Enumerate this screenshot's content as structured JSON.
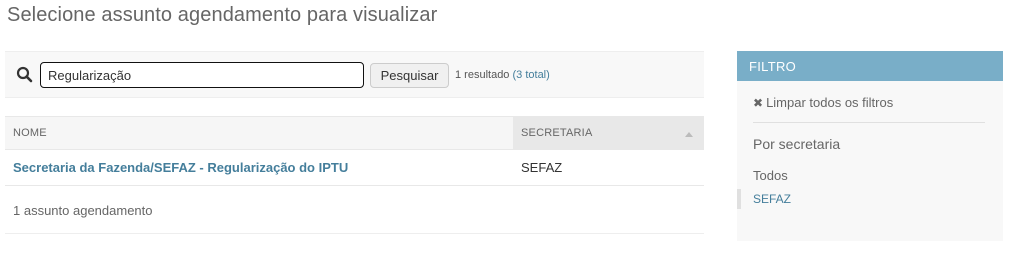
{
  "page": {
    "title": "Selecione assunto agendamento para visualizar"
  },
  "search": {
    "value": "Regularização",
    "button_label": "Pesquisar",
    "result_text": "1 resultado",
    "total_link": "(3 total)"
  },
  "table": {
    "columns": [
      "NOME",
      "SECRETARIA"
    ],
    "rows": [
      {
        "nome": "Secretaria da Fazenda/SEFAZ - Regularização do IPTU",
        "secretaria": "SEFAZ"
      }
    ],
    "footer": "1 assunto agendamento"
  },
  "filter": {
    "header": "FILTRO",
    "clear_label": "Limpar todos os filtros",
    "section_title": "Por secretaria",
    "options": [
      "Todos",
      "SEFAZ"
    ]
  },
  "colors": {
    "link": "#447e9b",
    "filter_header": "#79aec8"
  }
}
